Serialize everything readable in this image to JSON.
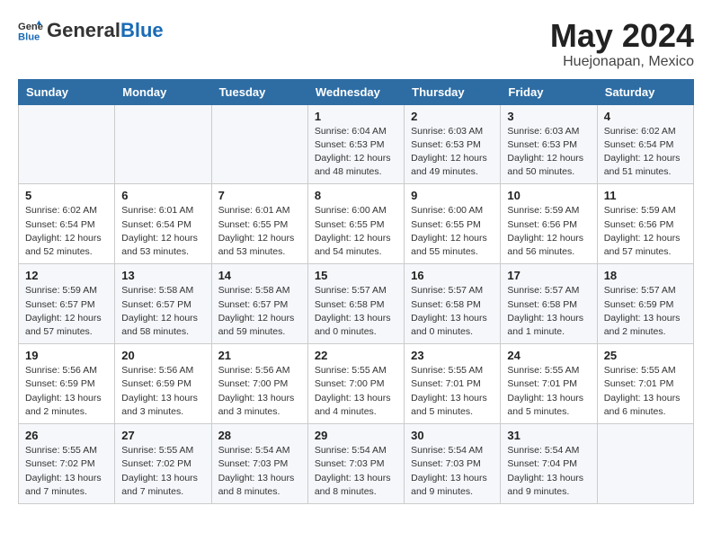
{
  "header": {
    "logo_general": "General",
    "logo_blue": "Blue",
    "month": "May 2024",
    "location": "Huejonapan, Mexico"
  },
  "days_of_week": [
    "Sunday",
    "Monday",
    "Tuesday",
    "Wednesday",
    "Thursday",
    "Friday",
    "Saturday"
  ],
  "weeks": [
    [
      {
        "day": "",
        "detail": ""
      },
      {
        "day": "",
        "detail": ""
      },
      {
        "day": "",
        "detail": ""
      },
      {
        "day": "1",
        "detail": "Sunrise: 6:04 AM\nSunset: 6:53 PM\nDaylight: 12 hours\nand 48 minutes."
      },
      {
        "day": "2",
        "detail": "Sunrise: 6:03 AM\nSunset: 6:53 PM\nDaylight: 12 hours\nand 49 minutes."
      },
      {
        "day": "3",
        "detail": "Sunrise: 6:03 AM\nSunset: 6:53 PM\nDaylight: 12 hours\nand 50 minutes."
      },
      {
        "day": "4",
        "detail": "Sunrise: 6:02 AM\nSunset: 6:54 PM\nDaylight: 12 hours\nand 51 minutes."
      }
    ],
    [
      {
        "day": "5",
        "detail": "Sunrise: 6:02 AM\nSunset: 6:54 PM\nDaylight: 12 hours\nand 52 minutes."
      },
      {
        "day": "6",
        "detail": "Sunrise: 6:01 AM\nSunset: 6:54 PM\nDaylight: 12 hours\nand 53 minutes."
      },
      {
        "day": "7",
        "detail": "Sunrise: 6:01 AM\nSunset: 6:55 PM\nDaylight: 12 hours\nand 53 minutes."
      },
      {
        "day": "8",
        "detail": "Sunrise: 6:00 AM\nSunset: 6:55 PM\nDaylight: 12 hours\nand 54 minutes."
      },
      {
        "day": "9",
        "detail": "Sunrise: 6:00 AM\nSunset: 6:55 PM\nDaylight: 12 hours\nand 55 minutes."
      },
      {
        "day": "10",
        "detail": "Sunrise: 5:59 AM\nSunset: 6:56 PM\nDaylight: 12 hours\nand 56 minutes."
      },
      {
        "day": "11",
        "detail": "Sunrise: 5:59 AM\nSunset: 6:56 PM\nDaylight: 12 hours\nand 57 minutes."
      }
    ],
    [
      {
        "day": "12",
        "detail": "Sunrise: 5:59 AM\nSunset: 6:57 PM\nDaylight: 12 hours\nand 57 minutes."
      },
      {
        "day": "13",
        "detail": "Sunrise: 5:58 AM\nSunset: 6:57 PM\nDaylight: 12 hours\nand 58 minutes."
      },
      {
        "day": "14",
        "detail": "Sunrise: 5:58 AM\nSunset: 6:57 PM\nDaylight: 12 hours\nand 59 minutes."
      },
      {
        "day": "15",
        "detail": "Sunrise: 5:57 AM\nSunset: 6:58 PM\nDaylight: 13 hours\nand 0 minutes."
      },
      {
        "day": "16",
        "detail": "Sunrise: 5:57 AM\nSunset: 6:58 PM\nDaylight: 13 hours\nand 0 minutes."
      },
      {
        "day": "17",
        "detail": "Sunrise: 5:57 AM\nSunset: 6:58 PM\nDaylight: 13 hours\nand 1 minute."
      },
      {
        "day": "18",
        "detail": "Sunrise: 5:57 AM\nSunset: 6:59 PM\nDaylight: 13 hours\nand 2 minutes."
      }
    ],
    [
      {
        "day": "19",
        "detail": "Sunrise: 5:56 AM\nSunset: 6:59 PM\nDaylight: 13 hours\nand 2 minutes."
      },
      {
        "day": "20",
        "detail": "Sunrise: 5:56 AM\nSunset: 6:59 PM\nDaylight: 13 hours\nand 3 minutes."
      },
      {
        "day": "21",
        "detail": "Sunrise: 5:56 AM\nSunset: 7:00 PM\nDaylight: 13 hours\nand 3 minutes."
      },
      {
        "day": "22",
        "detail": "Sunrise: 5:55 AM\nSunset: 7:00 PM\nDaylight: 13 hours\nand 4 minutes."
      },
      {
        "day": "23",
        "detail": "Sunrise: 5:55 AM\nSunset: 7:01 PM\nDaylight: 13 hours\nand 5 minutes."
      },
      {
        "day": "24",
        "detail": "Sunrise: 5:55 AM\nSunset: 7:01 PM\nDaylight: 13 hours\nand 5 minutes."
      },
      {
        "day": "25",
        "detail": "Sunrise: 5:55 AM\nSunset: 7:01 PM\nDaylight: 13 hours\nand 6 minutes."
      }
    ],
    [
      {
        "day": "26",
        "detail": "Sunrise: 5:55 AM\nSunset: 7:02 PM\nDaylight: 13 hours\nand 7 minutes."
      },
      {
        "day": "27",
        "detail": "Sunrise: 5:55 AM\nSunset: 7:02 PM\nDaylight: 13 hours\nand 7 minutes."
      },
      {
        "day": "28",
        "detail": "Sunrise: 5:54 AM\nSunset: 7:03 PM\nDaylight: 13 hours\nand 8 minutes."
      },
      {
        "day": "29",
        "detail": "Sunrise: 5:54 AM\nSunset: 7:03 PM\nDaylight: 13 hours\nand 8 minutes."
      },
      {
        "day": "30",
        "detail": "Sunrise: 5:54 AM\nSunset: 7:03 PM\nDaylight: 13 hours\nand 9 minutes."
      },
      {
        "day": "31",
        "detail": "Sunrise: 5:54 AM\nSunset: 7:04 PM\nDaylight: 13 hours\nand 9 minutes."
      },
      {
        "day": "",
        "detail": ""
      }
    ]
  ]
}
